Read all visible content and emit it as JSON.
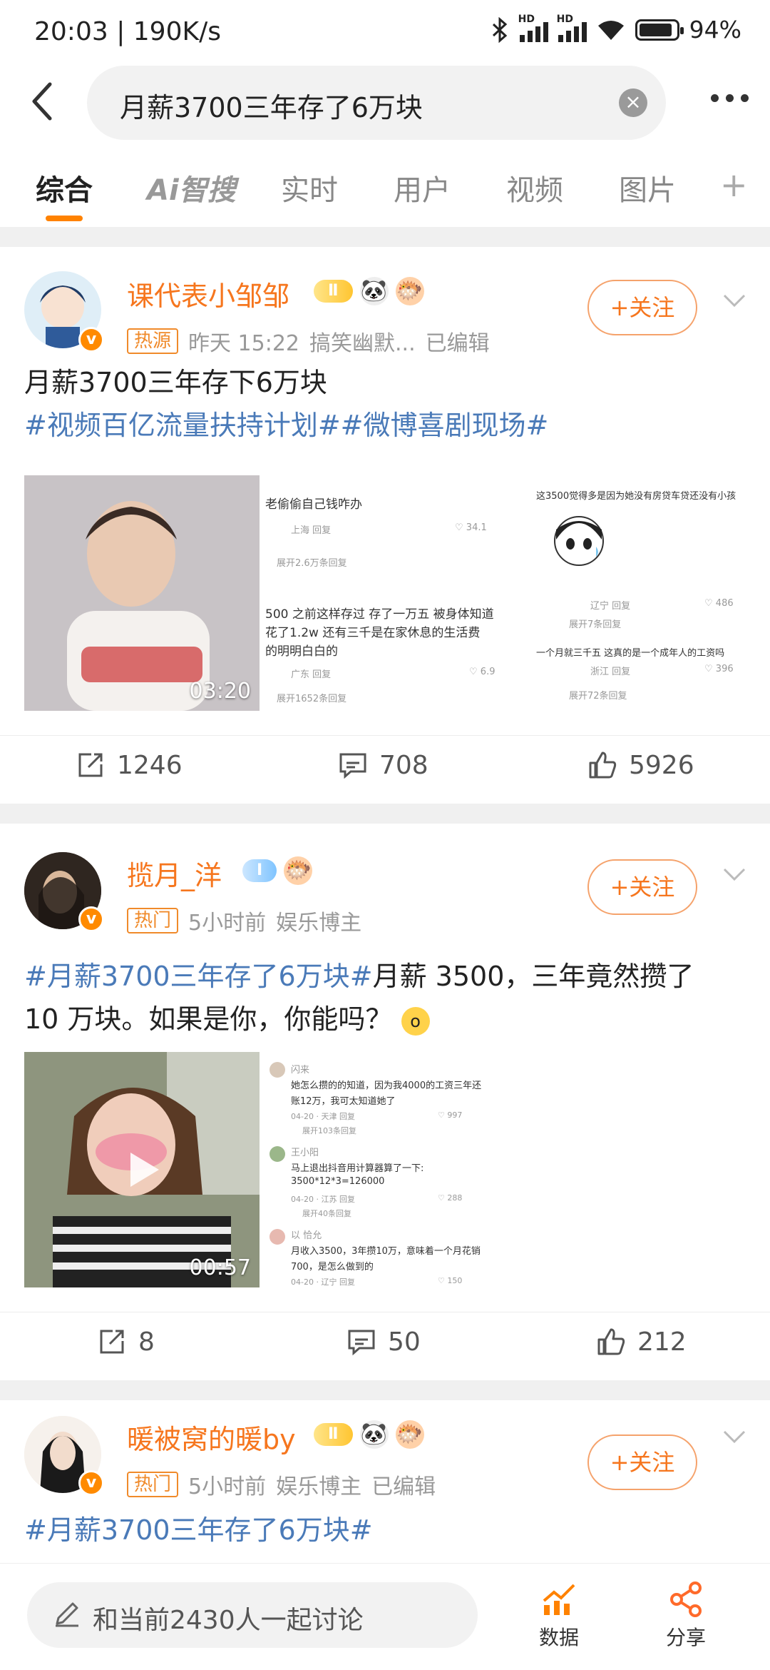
{
  "status": {
    "time": "20:03 | 190K/s",
    "battery": "94%"
  },
  "search": {
    "query": "月薪3700三年存了6万块"
  },
  "tabs": [
    "综合",
    "Ai智搜",
    "实时",
    "用户",
    "视频",
    "图片"
  ],
  "posts": [
    {
      "username": "课代表小邹邹",
      "level": "Ⅱ",
      "tag": "热源",
      "time": "昨天 15:22",
      "category": "搞笑幽默...",
      "edited": "已编辑",
      "follow": "+关注",
      "text": "月薪3700三年存下6万块",
      "hashtags": "#视频百亿流量扶持计划##微博喜剧现场#",
      "duration": "03:20",
      "screenshots": {
        "c1": "老偷偷自己钱咋办",
        "c1_meta": "上海    回复",
        "c1_likes": "34.1",
        "c1_more": "展开2.6万条回复",
        "c2a": "500 之前这样存过 存了一万五 被身体知道",
        "c2b": "花了1.2w 还有三千是在家休息的生活费",
        "c2c": "的明明白白的",
        "c2_meta": "广东    回复",
        "c2_likes": "6.9",
        "c2_more": "展开1652条回复",
        "c3": "这3500觉得多是因为她没有房贷车贷还没有小孩",
        "c3_meta": "辽宁    回复",
        "c3_likes": "486",
        "c3_more": "展开7条回复",
        "c4": "一个月就三千五 这真的是一个成年人的工资吗",
        "c4_meta": "浙江    回复",
        "c4_likes": "396",
        "c4_more": "展开72条回复"
      },
      "shares": "1246",
      "comments": "708",
      "likes": "5926"
    },
    {
      "username": "揽月_洋",
      "level": "Ⅰ",
      "tag": "热门",
      "time": "5小时前",
      "category": "娱乐博主",
      "follow": "+关注",
      "hashtag": "#月薪3700三年存了6万块#",
      "text1": "月薪 3500，三年竟然攒了",
      "text2": "10 万块。如果是你，你能吗？",
      "duration": "00:57",
      "screenshots": {
        "u1": "闪来",
        "c1a": "她怎么攒的的知道，因为我4000的工资三年还",
        "c1b": "账12万，我可太知道她了",
        "c1_meta": "04-20 · 天津   回复",
        "c1_likes": "997",
        "c1_more": "展开103条回复",
        "u2": "王小阳",
        "c2a": "马上退出抖音用计算器算了一下:",
        "c2b": "3500*12*3=126000",
        "c2_meta": "04-20 · 江苏   回复",
        "c2_likes": "288",
        "c2_more": "展开40条回复",
        "u3": "以 恰允",
        "c3a": "月收入3500，3年攒10万，意味着一个月花销",
        "c3b": "700，是怎么做到的",
        "c3_meta": "04-20 · 辽宁   回复",
        "c3_likes": "150"
      },
      "shares": "8",
      "comments": "50",
      "likes": "212"
    },
    {
      "username": "暖被窝的暖by",
      "level": "Ⅱ",
      "tag": "热门",
      "time": "5小时前",
      "category": "娱乐博主",
      "edited": "已编辑",
      "follow": "+关注",
      "hashtag": "#月薪3700三年存了6万块#"
    }
  ],
  "bottom": {
    "discuss": "和当前2430人一起讨论",
    "data": "数据",
    "share": "分享"
  },
  "colors": {
    "accent": "#ff8200",
    "link": "#4a7ab8",
    "username": "#f6761e"
  }
}
